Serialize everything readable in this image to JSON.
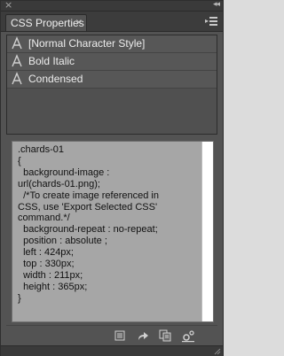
{
  "panel": {
    "tab_label": "CSS Properties",
    "tab_close": "×",
    "window_close": "×",
    "collapse_glyph": "◂◂",
    "menu_icon": "panel-menu-icon"
  },
  "styles": [
    {
      "label": "[Normal Character Style]",
      "icon": "character-style-icon"
    },
    {
      "label": "Bold Italic",
      "icon": "character-style-icon"
    },
    {
      "label": "Condensed",
      "icon": "character-style-icon"
    }
  ],
  "css_code": ".chards-01\n{\n  background-image :\nurl(chards-01.png);\n  /*To create image referenced in\nCSS, use 'Export Selected CSS'\ncommand.*/\n  background-repeat : no-repeat;\n  position : absolute ;\n  left : 424px;\n  top : 330px;\n  width : 211px;\n  height : 365px;\n}",
  "footer_icons": [
    "clear-overrides-icon",
    "export-icon",
    "copy-css-icon",
    "settings-icon"
  ],
  "colors": {
    "panel_bg": "#535353",
    "code_bg": "#a6a6a6",
    "text_light": "#ededed"
  }
}
